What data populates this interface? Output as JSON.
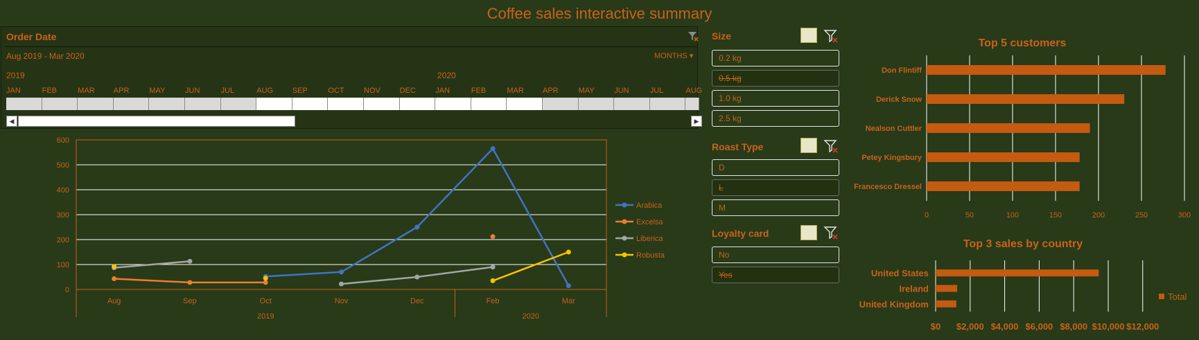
{
  "page_title": "Coffee sales interactive summary",
  "timeline": {
    "header": "Order Date",
    "range": "Aug 2019 - Mar 2020",
    "level": "MONTHS",
    "years": [
      "2019",
      "2020"
    ],
    "months": [
      "JAN",
      "FEB",
      "MAR",
      "APR",
      "MAY",
      "JUN",
      "JUL",
      "AUG",
      "SEP",
      "OCT",
      "NOV",
      "DEC",
      "JAN",
      "FEB",
      "MAR",
      "APR",
      "MAY",
      "JUN",
      "JUL",
      "AUG"
    ],
    "selected_from_index": 7,
    "selected_to_index": 14
  },
  "slicers": {
    "size": {
      "header": "Size",
      "items": [
        {
          "label": "0.2 kg",
          "selected": true
        },
        {
          "label": "0.5 kg",
          "selected": false
        },
        {
          "label": "1.0 kg",
          "selected": true
        },
        {
          "label": "2.5 kg",
          "selected": true
        }
      ]
    },
    "roast": {
      "header": "Roast Type",
      "items": [
        {
          "label": "D",
          "selected": true
        },
        {
          "label": "L",
          "selected": false
        },
        {
          "label": "M",
          "selected": true
        }
      ]
    },
    "loyalty": {
      "header": "Loyalty card",
      "items": [
        {
          "label": "No",
          "selected": true
        },
        {
          "label": "Yes",
          "selected": false
        }
      ]
    }
  },
  "colors": {
    "background": "#283a18",
    "accent": "#c9621c",
    "arabica": "#4472c4",
    "excelsa": "#ed7d31",
    "liberica": "#a5a5a5",
    "robusta": "#ffc000",
    "bar": "#c55a11"
  },
  "chart_data": [
    {
      "type": "line",
      "title": "",
      "categories": [
        "Aug",
        "Sep",
        "Oct",
        "Nov",
        "Dec",
        "Feb",
        "Mar"
      ],
      "group_labels": [
        {
          "label": "2019",
          "from": 0,
          "to": 4
        },
        {
          "label": "2020",
          "from": 5,
          "to": 6
        }
      ],
      "ylim": [
        0,
        600
      ],
      "yticks": [
        0,
        100,
        200,
        300,
        400,
        500,
        600
      ],
      "grid": true,
      "legend_position": "right",
      "series": [
        {
          "name": "Arabica",
          "color": "#4472c4",
          "values": [
            null,
            null,
            52,
            70,
            250,
            565,
            15
          ]
        },
        {
          "name": "Excelsa",
          "color": "#ed7d31",
          "values": [
            43,
            28,
            28,
            null,
            null,
            212,
            null
          ]
        },
        {
          "name": "Liberica",
          "color": "#a5a5a5",
          "values": [
            87,
            113,
            null,
            22,
            50,
            90,
            null
          ]
        },
        {
          "name": "Robusta",
          "color": "#ffc000",
          "values": [
            92,
            null,
            45,
            null,
            null,
            35,
            150
          ]
        }
      ]
    },
    {
      "type": "bar",
      "orientation": "horizontal",
      "title": "Top 5 customers",
      "categories": [
        "Don Flintiff",
        "Derick Snow",
        "Nealson Cuttler",
        "Petey Kingsbury",
        "Francesco Dressel"
      ],
      "values": [
        278,
        230,
        190,
        178,
        178
      ],
      "xlim": [
        0,
        300
      ],
      "xticks": [
        0,
        50,
        100,
        150,
        200,
        250,
        300
      ],
      "grid": true
    },
    {
      "type": "bar",
      "orientation": "horizontal",
      "title": "Top 3 sales by country",
      "categories": [
        "United States",
        "Ireland",
        "United Kingdom"
      ],
      "values": [
        9450,
        1250,
        1200
      ],
      "xlim": [
        0,
        12000
      ],
      "xticks": [
        "$0",
        "$2,000",
        "$4,000",
        "$6,000",
        "$8,000",
        "$10,000",
        "$12,000"
      ],
      "series_name": "Total",
      "legend_position": "right",
      "grid": true
    }
  ]
}
